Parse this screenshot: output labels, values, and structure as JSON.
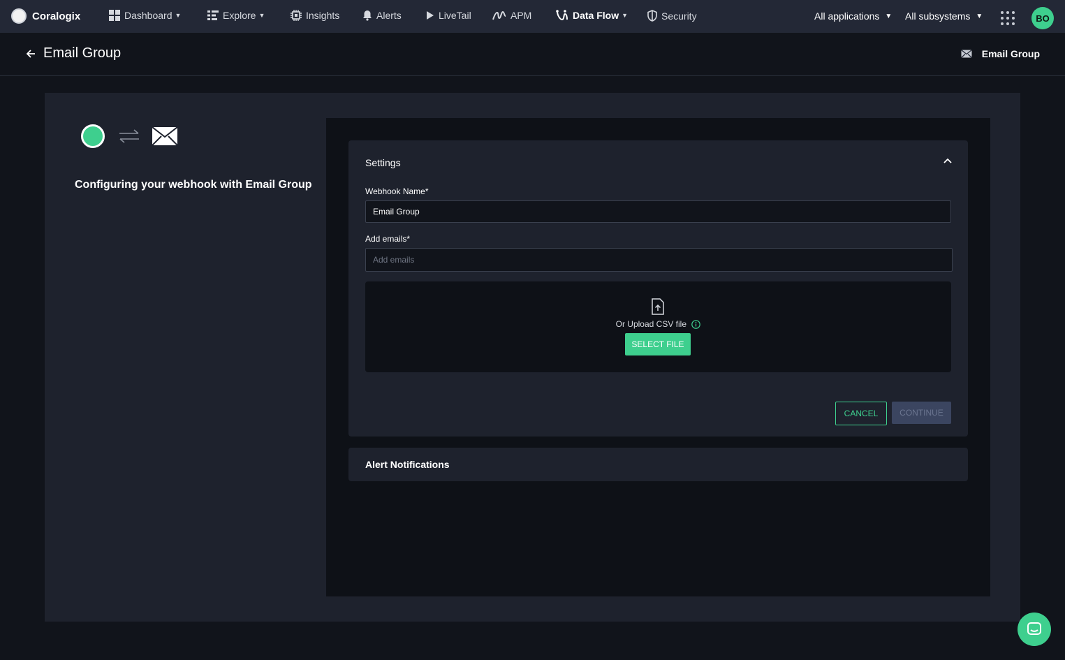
{
  "brand": {
    "name": "Coralogix"
  },
  "nav": {
    "dashboard": "Dashboard",
    "explore": "Explore",
    "insights": "Insights",
    "alerts": "Alerts",
    "livetail": "LiveTail",
    "apm": "APM",
    "dataflow": "Data Flow",
    "security": "Security",
    "applications": "All applications",
    "subsystems": "All subsystems",
    "avatar_initials": "BO"
  },
  "header": {
    "title": "Email Group",
    "integration_label": "Email Group"
  },
  "side": {
    "description": "Configuring your webhook with Email Group"
  },
  "settings": {
    "title": "Settings",
    "webhook_name_label": "Webhook Name*",
    "webhook_name_value": "Email Group",
    "emails_label": "Add emails*",
    "emails_placeholder": "Add emails",
    "upload_text": "Or Upload CSV file",
    "select_file_label": "SELECT FILE",
    "cancel_label": "CANCEL",
    "continue_label": "CONTINUE"
  },
  "alert_notifications": {
    "title": "Alert Notifications"
  },
  "colors": {
    "accent": "#3ecf8e",
    "topbar": "#232836",
    "panel": "#1e222d",
    "background": "#11141b"
  }
}
